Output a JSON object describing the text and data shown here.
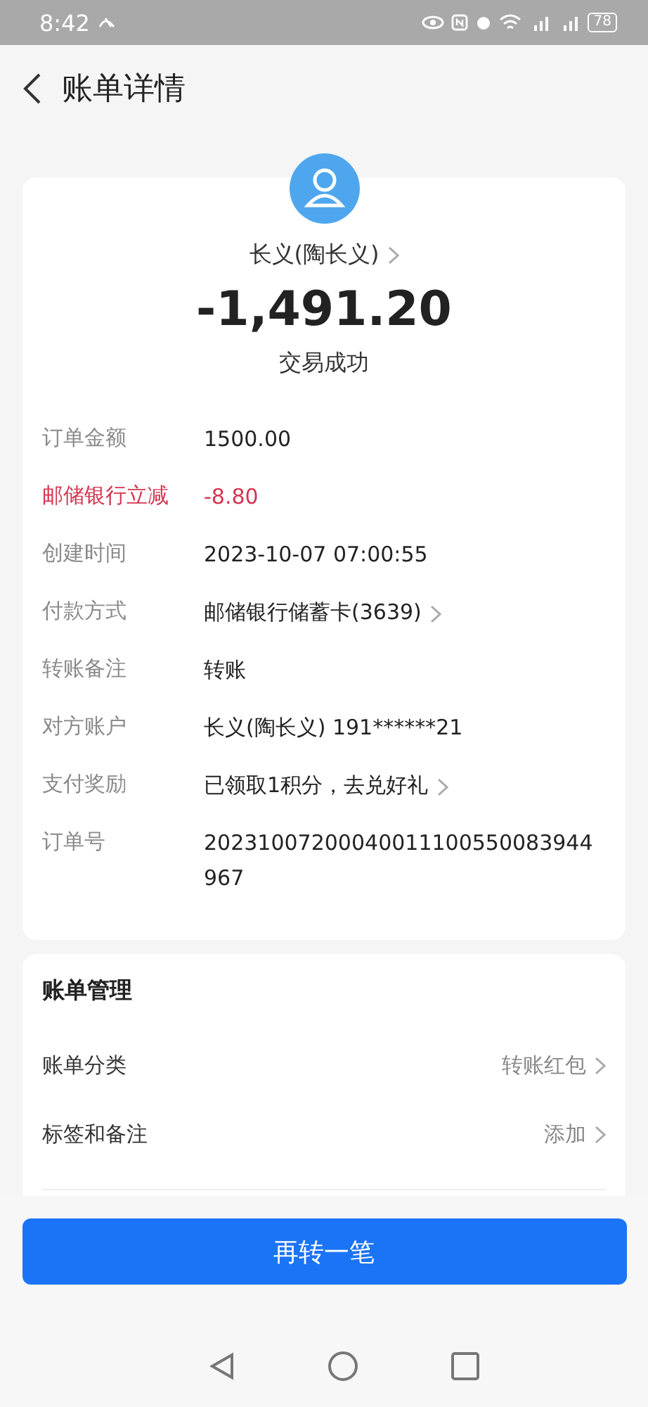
{
  "status_bar": {
    "time": "8:42",
    "battery": "78"
  },
  "header": {
    "title": "账单详情"
  },
  "summary": {
    "payee": "长义(陶长义)",
    "amount": "-1,491.20",
    "status": "交易成功"
  },
  "details": [
    {
      "label": "订单金额",
      "value": "1500.00",
      "kind": "plain"
    },
    {
      "label": "邮储银行立减",
      "value": "-8.80",
      "kind": "discount"
    },
    {
      "label": "创建时间",
      "value": "2023-10-07 07:00:55",
      "kind": "plain"
    },
    {
      "label": "付款方式",
      "value": "邮储银行储蓄卡(3639)",
      "kind": "link"
    },
    {
      "label": "转账备注",
      "value": "转账",
      "kind": "plain"
    },
    {
      "label": "对方账户",
      "value": "长义(陶长义) 191******21",
      "kind": "plain"
    },
    {
      "label": "支付奖励",
      "value": "已领取1积分，去兑好礼",
      "kind": "link"
    },
    {
      "label": "订单号",
      "value": "20231007200040011100550083944967",
      "kind": "plain"
    }
  ],
  "management": {
    "title": "账单管理",
    "items": [
      {
        "label": "账单分类",
        "value": "转账红包"
      },
      {
        "label": "标签和备注",
        "value": "添加"
      }
    ]
  },
  "action_button": "再转一笔"
}
